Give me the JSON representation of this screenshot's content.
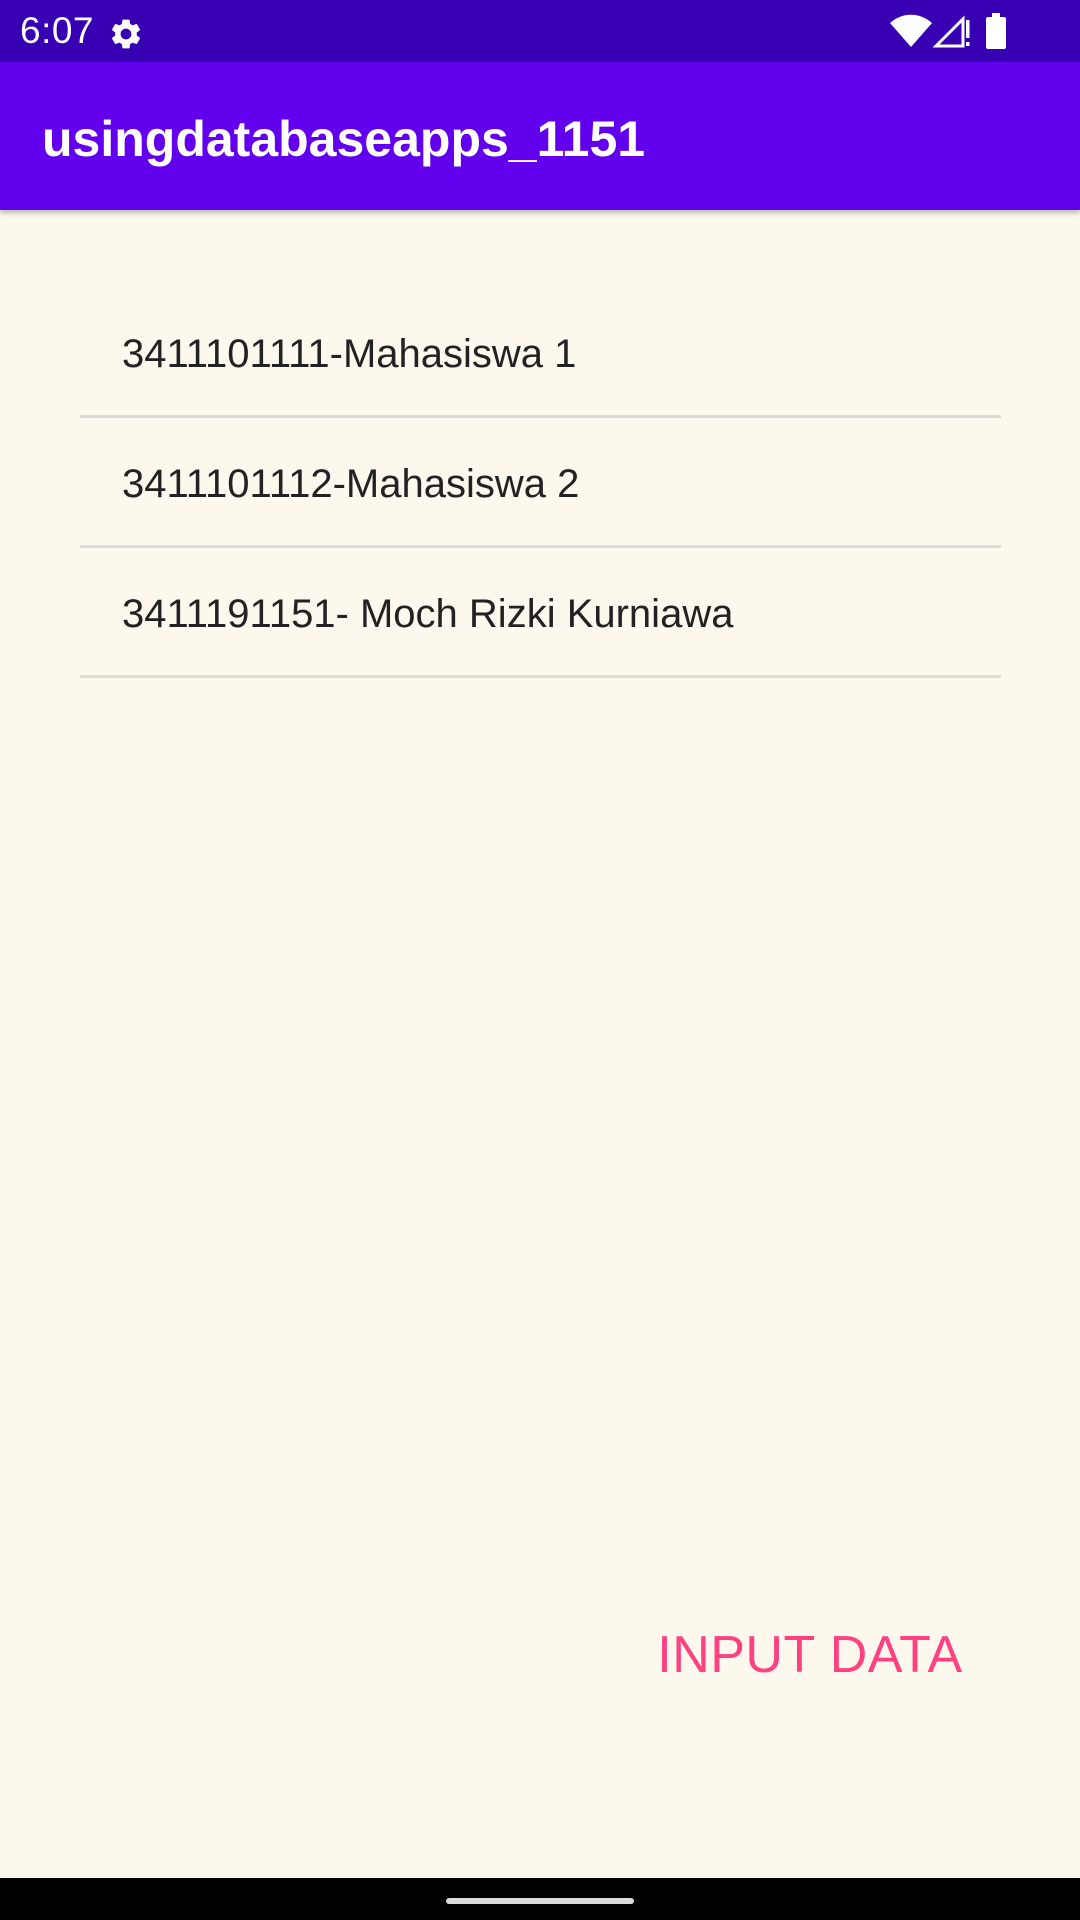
{
  "status_bar": {
    "time": "6:07",
    "icons": [
      "gear-icon",
      "wifi-icon",
      "cell-signal-icon",
      "battery-icon"
    ]
  },
  "app_bar": {
    "title": "usingdatabaseapps_1151",
    "color": "#6200EE"
  },
  "list": {
    "items": [
      {
        "label": "3411101111-Mahasiswa 1"
      },
      {
        "label": "3411101112-Mahasiswa 2"
      },
      {
        "label": "3411191151- Moch Rizki Kurniawa"
      }
    ]
  },
  "actions": {
    "input_label": "INPUT DATA",
    "accent_color": "#FF4081"
  }
}
